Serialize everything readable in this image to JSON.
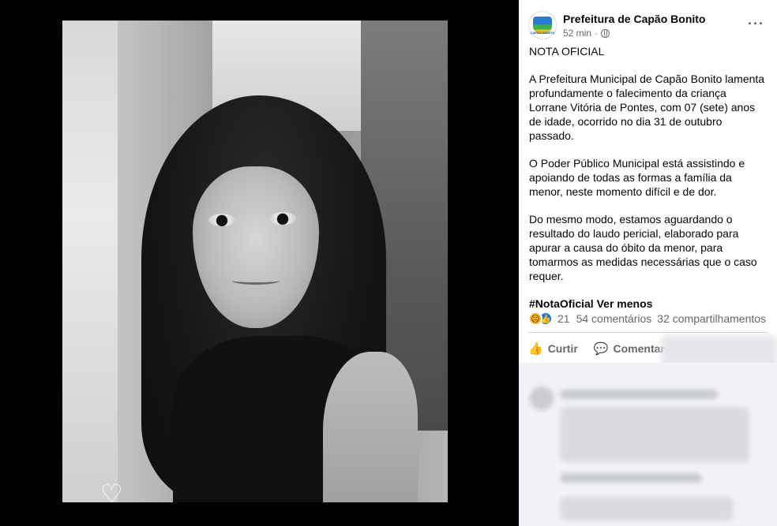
{
  "post": {
    "page_name": "Prefeitura de Capão Bonito",
    "avatar_label": "CAPÃO BONITO",
    "time": "52 min",
    "audience_icon": "globe-icon",
    "more_icon": "more-icon",
    "paragraphs": [
      "NOTA OFICIAL",
      "A Prefeitura Municipal de Capão Bonito lamenta profundamente o falecimento da criança Lorrane Vitória de Pontes, com 07 (sete) anos de idade, ocorrido no dia 31 de outubro passado.",
      "O Poder Público Municipal está assistindo e apoiando de todas as formas a família da menor, neste momento difícil e de dor.",
      "Do mesmo modo, estamos aguardando o resultado do laudo pericial, elaborado para apurar a causa do óbito da menor, para tomarmos as medidas necessárias que o caso requer."
    ],
    "hashtag": "#NotaOficial",
    "see_less": "Ver menos"
  },
  "stats": {
    "reactions": [
      "sad-reaction-icon",
      "like-reaction-icon"
    ],
    "reaction_count": "21",
    "comments": "54 comentários",
    "shares": "32 compartilhamentos"
  },
  "actions": {
    "like_label": "Curtir",
    "comment_label": "Comentar"
  }
}
